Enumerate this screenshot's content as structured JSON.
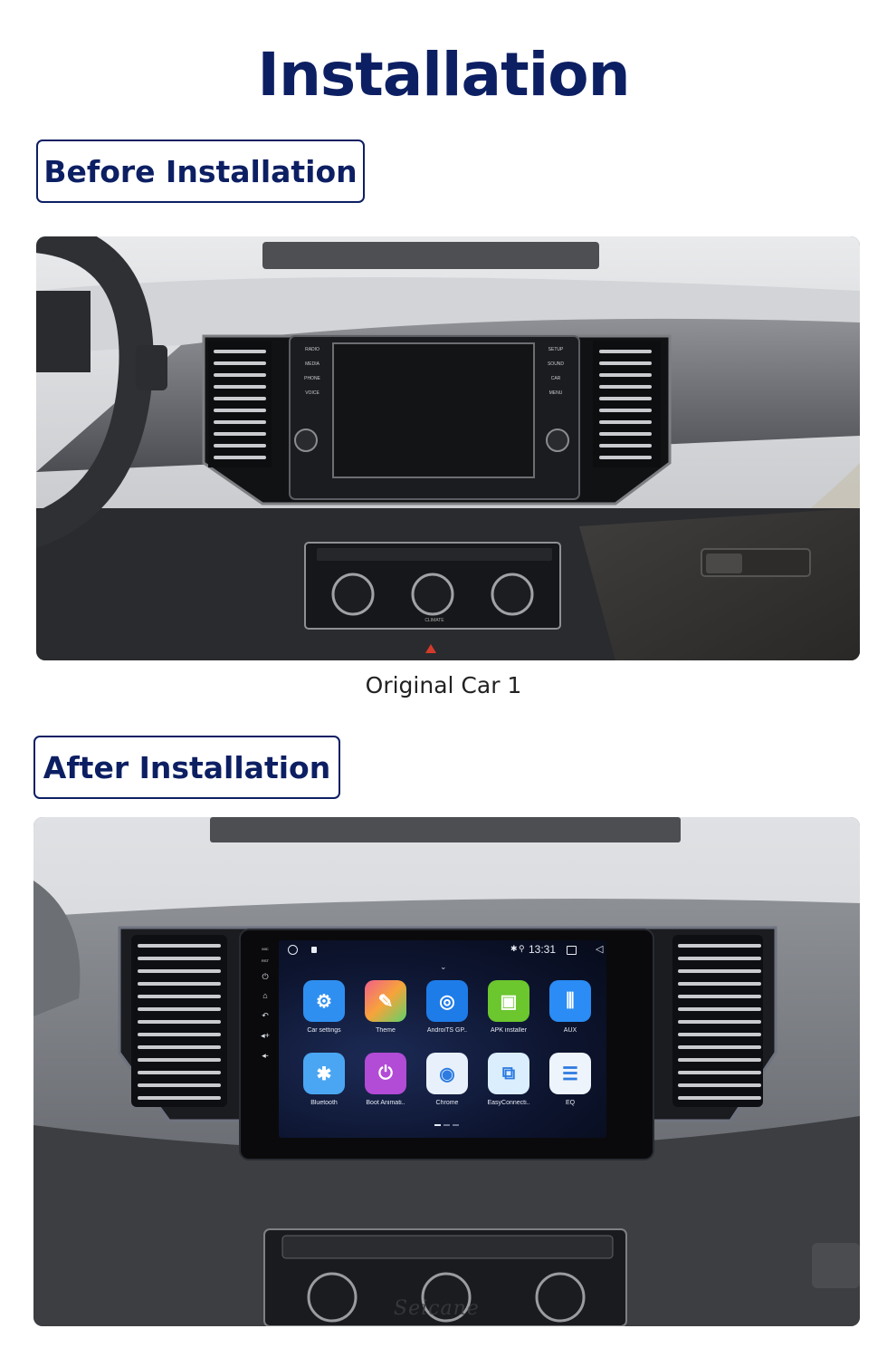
{
  "page": {
    "title": "Installation",
    "sections": {
      "before": {
        "label": "Before Installation",
        "caption": "Original Car  1"
      },
      "after": {
        "label": "After Installation"
      }
    }
  },
  "original_head_unit": {
    "left_buttons": [
      "RADIO",
      "MEDIA",
      "PHONE",
      "VOICE"
    ],
    "right_buttons": [
      "SETUP",
      "SOUND",
      "CAR",
      "MENU"
    ],
    "climate_label": "CLIMATE"
  },
  "android_unit": {
    "status_bar": {
      "time": "13:31",
      "icons": [
        "home-circle-icon",
        "gallery-icon",
        "bluetooth-icon",
        "location-icon",
        "recents-icon",
        "back-icon"
      ]
    },
    "side_buttons": [
      "MIC",
      "RST",
      "power-icon",
      "home-icon",
      "back-icon",
      "volume-up-icon",
      "volume-down-icon"
    ],
    "side_labels": {
      "mic": "MIC",
      "rst": "RST"
    },
    "apps": [
      {
        "label": "Car settings",
        "icon": "car-settings-icon",
        "color": "#2f8ff0"
      },
      {
        "label": "Theme",
        "icon": "theme-brush-icon",
        "color": "#f06e6e"
      },
      {
        "label": "AndroiTS GP..",
        "icon": "gps-radar-icon",
        "color": "#1e7ce8"
      },
      {
        "label": "APK installer",
        "icon": "android-icon",
        "color": "#6cc62e"
      },
      {
        "label": "AUX",
        "icon": "aux-cable-icon",
        "color": "#2a8cf4"
      },
      {
        "label": "Bluetooth",
        "icon": "bluetooth-icon",
        "color": "#4aa6f3"
      },
      {
        "label": "Boot Animati..",
        "icon": "power-icon",
        "color": "#b24bd6"
      },
      {
        "label": "Chrome",
        "icon": "chrome-icon",
        "color": "#e8f1fb"
      },
      {
        "label": "EasyConnecti..",
        "icon": "easyconnection-icon",
        "color": "#dbeefd"
      },
      {
        "label": "EQ",
        "icon": "eq-sliders-icon",
        "color": "#eef4fc"
      }
    ],
    "page_indicator": {
      "pages": 3,
      "current": 1
    }
  },
  "watermark": "Seicane"
}
